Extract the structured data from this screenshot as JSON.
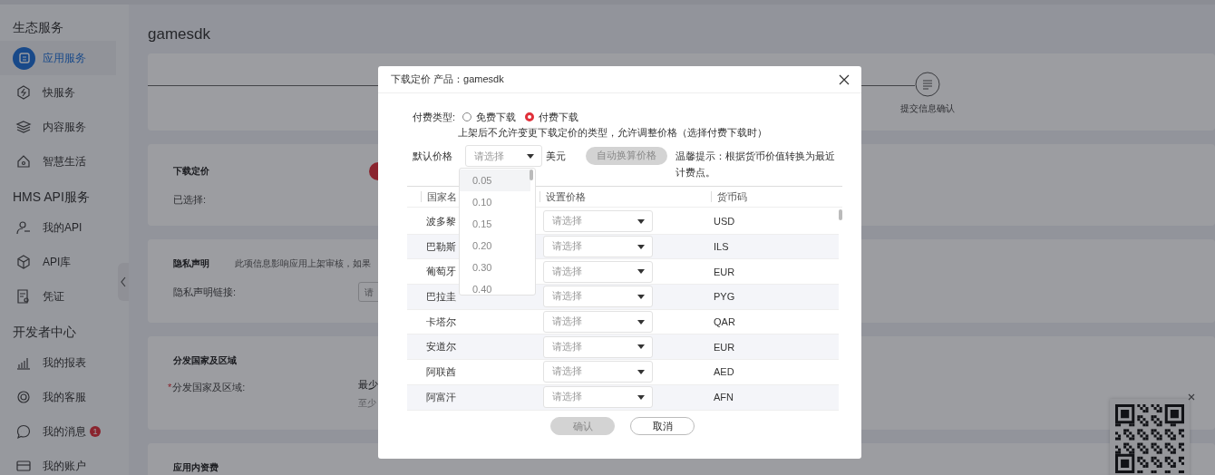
{
  "sidebar": {
    "sections": [
      {
        "title": "生态服务",
        "items": [
          {
            "label": "应用服务",
            "selected": true
          },
          {
            "label": "快服务",
            "selected": false
          },
          {
            "label": "内容服务",
            "selected": false
          },
          {
            "label": "智慧生活",
            "selected": false
          }
        ]
      },
      {
        "title": "HMS API服务",
        "items": [
          {
            "label": "我的API",
            "selected": false
          },
          {
            "label": "API库",
            "selected": false
          },
          {
            "label": "凭证",
            "selected": false
          }
        ]
      },
      {
        "title": "开发者中心",
        "items": [
          {
            "label": "我的报表",
            "selected": false
          },
          {
            "label": "我的客服",
            "selected": false
          },
          {
            "label": "我的消息",
            "selected": false,
            "badge": "1"
          },
          {
            "label": "我的账户",
            "selected": false
          }
        ]
      }
    ]
  },
  "page": {
    "title": "gamesdk",
    "steps": [
      {
        "label": "提交信息确认"
      }
    ],
    "pricing_card": {
      "title": "下载定价",
      "selected_label": "已选择:"
    },
    "privacy_card": {
      "title": "隐私声明",
      "note": "此项信息影响应用上架审核，如果",
      "link_label": "隐私声明链接:",
      "link_placeholder": "请"
    },
    "distribution_card": {
      "title": "分发国家及区域",
      "field_label": "分发国家及区域:",
      "required_mark": "*",
      "value": "最少",
      "hint": "至少"
    },
    "in_app_card": {
      "title": "应用内资费"
    }
  },
  "dialog": {
    "title": "下载定价 产品：gamesdk",
    "payment_type": {
      "label": "付费类型:",
      "options": [
        {
          "label": "免费下载",
          "selected": false
        },
        {
          "label": "付费下载",
          "selected": true
        }
      ],
      "note": "上架后不允许变更下载定价的类型，允许调整价格（选择付费下载时）"
    },
    "default_price": {
      "label": "默认价格",
      "placeholder": "请选择",
      "unit": "美元",
      "convert_button": {
        "label": "自动换算价格",
        "disabled": true
      },
      "tip": "温馨提示：根据货币价值转换为最近计费点。",
      "dropdown": [
        {
          "label": "0.05",
          "selected": true
        },
        {
          "label": "0.10",
          "selected": false
        },
        {
          "label": "0.15",
          "selected": false
        },
        {
          "label": "0.20",
          "selected": false
        },
        {
          "label": "0.30",
          "selected": false
        },
        {
          "label": "0.40",
          "selected": false
        }
      ]
    },
    "table": {
      "columns": [
        "国家名",
        "设置价格",
        "货币码"
      ],
      "rows": [
        {
          "country": "波多黎",
          "price_placeholder": "请选择",
          "currency": "USD"
        },
        {
          "country": "巴勒斯",
          "price_placeholder": "请选择",
          "currency": "ILS"
        },
        {
          "country": "葡萄牙",
          "price_placeholder": "请选择",
          "currency": "EUR"
        },
        {
          "country": "巴拉圭",
          "price_placeholder": "请选择",
          "currency": "PYG"
        },
        {
          "country": "卡塔尔",
          "price_placeholder": "请选择",
          "currency": "QAR"
        },
        {
          "country": "安道尔",
          "price_placeholder": "请选择",
          "currency": "EUR"
        },
        {
          "country": "阿联酋",
          "price_placeholder": "请选择",
          "currency": "AED"
        },
        {
          "country": "阿富汗",
          "price_placeholder": "请选择",
          "currency": "AFN"
        }
      ]
    },
    "buttons": [
      {
        "label": "确认",
        "disabled": true
      },
      {
        "label": "取消",
        "disabled": false
      }
    ]
  }
}
